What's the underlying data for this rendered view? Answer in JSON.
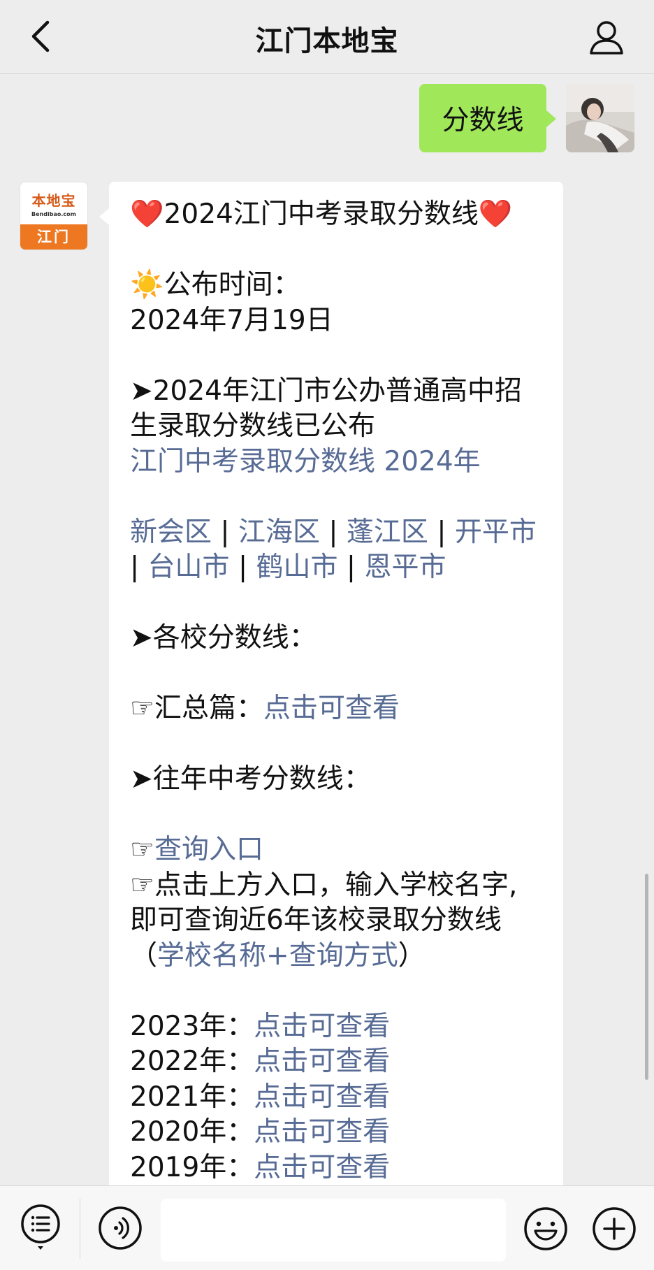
{
  "header": {
    "title": "江门本地宝"
  },
  "sent_message": {
    "text": "分数线"
  },
  "bot": {
    "avatar_brand": "本地宝",
    "avatar_domain": "Bendibao.com",
    "avatar_city": "江门"
  },
  "reply": {
    "heading": "2024江门中考录取分数线",
    "heart": "❤️",
    "sun": "☀️",
    "publish_label": "公布时间：",
    "publish_date": "2024年7月19日",
    "arrow": "➤",
    "pointer": "☞",
    "notice_line1": "2024年江门市公办普通高中招",
    "notice_line2": "生录取分数线已公布",
    "main_link": "江门中考录取分数线 2024年",
    "districts": [
      "新会区",
      "江海区",
      "蓬江区",
      "开平市",
      "台山市",
      "鹤山市",
      "恩平市"
    ],
    "sep": " | ",
    "schools_label": "各校分数线：",
    "summary_label": "汇总篇：",
    "summary_link": "点击可查看",
    "past_label": "往年中考分数线：",
    "query_link": "查询入口",
    "query_desc1": "点击上方入口，输入学校名字,",
    "query_desc2": "即可查询近6年该校录取分数线",
    "paren_open": "（",
    "query_hint": "学校名称+查询方式",
    "paren_close": "）",
    "years": [
      {
        "year": "2023年：",
        "link": "点击可查看"
      },
      {
        "year": "2022年：",
        "link": "点击可查看"
      },
      {
        "year": "2021年：",
        "link": "点击可查看"
      },
      {
        "year": "2020年：",
        "link": "点击可查看"
      },
      {
        "year": "2019年：",
        "link": "点击可查看"
      }
    ]
  },
  "input": {
    "placeholder": ""
  },
  "icons": {
    "back": "chevron-left-icon",
    "profile": "person-icon",
    "menu": "list-menu-icon",
    "voice": "voice-icon",
    "emoji": "smiley-icon",
    "plus": "plus-icon"
  },
  "colors": {
    "background": "#ededed",
    "sent_bubble": "#a0e75a",
    "link": "#576b95",
    "heart": "#e8202a",
    "brand_orange": "#ee7722"
  }
}
